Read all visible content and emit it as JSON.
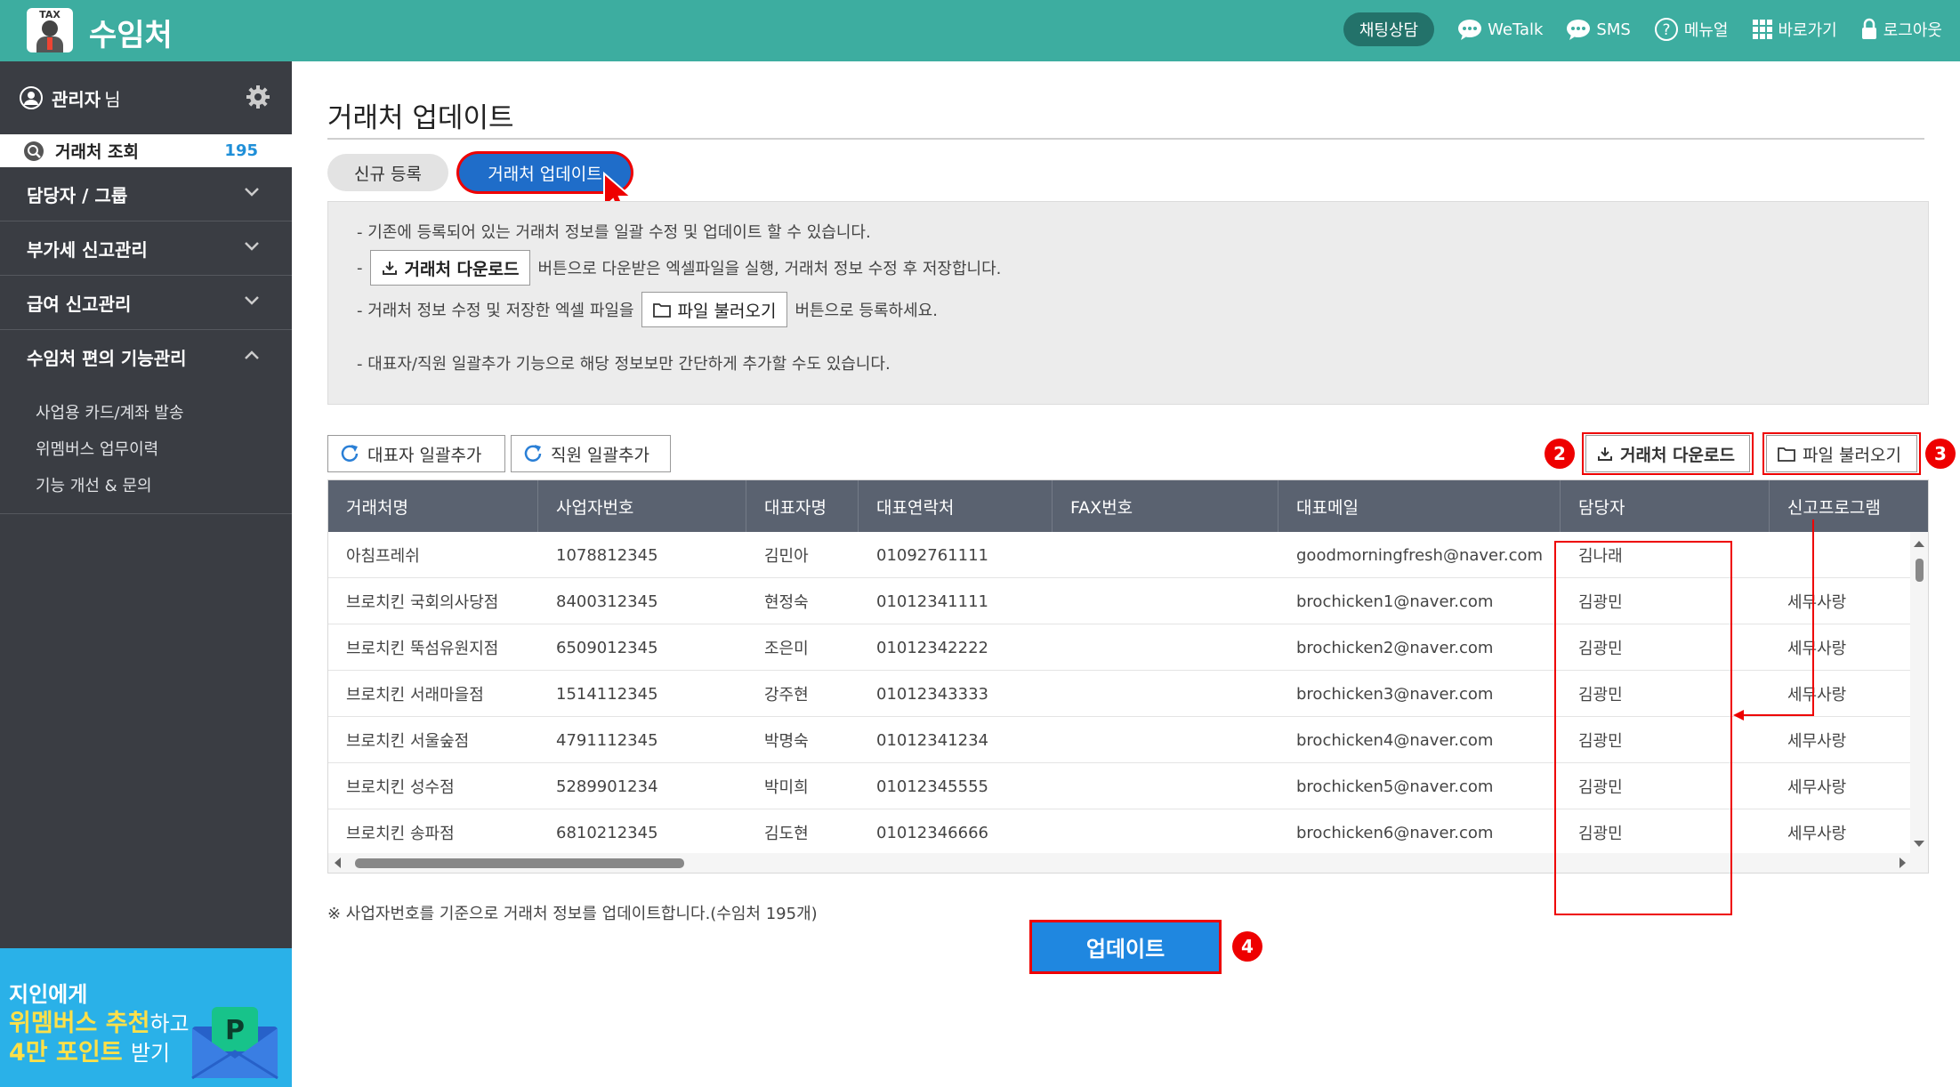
{
  "app": {
    "logo_text": "TAX",
    "title": "수임처"
  },
  "topnav": {
    "chat": "채팅상담",
    "wetalk": "WeTalk",
    "sms": "SMS",
    "manual": "메뉴얼",
    "shortcut": "바로가기",
    "logout": "로그아웃"
  },
  "sidebar": {
    "admin_name": "관리자",
    "admin_suffix": "님",
    "active_item": {
      "label": "거래처 조회",
      "count": "195"
    },
    "menus": [
      {
        "label": "담당자 / 그룹"
      },
      {
        "label": "부가세 신고관리"
      },
      {
        "label": "급여 신고관리"
      },
      {
        "label": "수임처 편의 기능관리"
      }
    ],
    "sub_items": [
      "사업용 카드/계좌 발송",
      "위멤버스 업무이력",
      "기능 개선 & 문의"
    ],
    "banner": {
      "line1": "지인에게",
      "line2_hl": "위멤버스 추천",
      "line2_sfx": "하고",
      "line3_hl": "4만 포인트",
      "line3_sfx": "받기",
      "badge_letter": "P"
    }
  },
  "main": {
    "page_title": "거래처 업데이트",
    "tabs": {
      "new": "신규 등록",
      "update": "거래처 업데이트"
    },
    "info": {
      "line1": "- 기존에 등록되어 있는 거래처 정보를 일괄 수정 및 업데이트 할 수 있습니다.",
      "line2_pre": "-",
      "line2_btn": "거래처 다운로드",
      "line2_post": "버튼으로 다운받은 엑셀파일을 실행, 거래처 정보 수정 후 저장합니다.",
      "line3_pre": "- 거래처 정보 수정 및 저장한 엑셀 파일을",
      "line3_btn": "파일 불러오기",
      "line3_post": "버튼으로 등록하세요.",
      "line4": "- 대표자/직원 일괄추가 기능으로 해당 정보보만 간단하게 추가할 수도 있습니다."
    },
    "buttons": {
      "add_ceo": "대표자 일괄추가",
      "add_staff": "직원 일괄추가",
      "download": "거래처 다운로드",
      "load_file": "파일 불러오기",
      "update": "업데이트"
    },
    "badges": [
      "2",
      "3",
      "4"
    ],
    "table": {
      "columns": [
        "거래처명",
        "사업자번호",
        "대표자명",
        "대표연락처",
        "FAX번호",
        "대표메일",
        "담당자",
        "신고프로그램"
      ],
      "rows": [
        [
          "아침프레쉬",
          "1078812345",
          "김민아",
          "01092761111",
          "",
          "goodmorningfresh@naver.com",
          "김나래",
          ""
        ],
        [
          "브로치킨 국회의사당점",
          "8400312345",
          "현정숙",
          "01012341111",
          "",
          "brochicken1@naver.com",
          "김광민",
          "세무사랑"
        ],
        [
          "브로치킨 뚝섬유원지점",
          "6509012345",
          "조은미",
          "01012342222",
          "",
          "brochicken2@naver.com",
          "김광민",
          "세무사랑"
        ],
        [
          "브로치킨 서래마을점",
          "1514112345",
          "강주현",
          "01012343333",
          "",
          "brochicken3@naver.com",
          "김광민",
          "세무사랑"
        ],
        [
          "브로치킨 서울숲점",
          "4791112345",
          "박명숙",
          "01012341234",
          "",
          "brochicken4@naver.com",
          "김광민",
          "세무사랑"
        ],
        [
          "브로치킨 성수점",
          "5289901234",
          "박미희",
          "01012345555",
          "",
          "brochicken5@naver.com",
          "김광민",
          "세무사랑"
        ],
        [
          "브로치킨 송파점",
          "6810212345",
          "김도현",
          "01012346666",
          "",
          "brochicken6@naver.com",
          "김광민",
          "세무사랑"
        ]
      ]
    },
    "note": "※ 사업자번호를 기준으로 거래처 정보를 업데이트합니다.(수임처 195개)"
  },
  "colors": {
    "topbar": "#3dada0",
    "sidebar": "#3a3d43",
    "accent_blue": "#1f6dc9",
    "highlight_red": "#e00000",
    "table_header": "#5a6270"
  }
}
